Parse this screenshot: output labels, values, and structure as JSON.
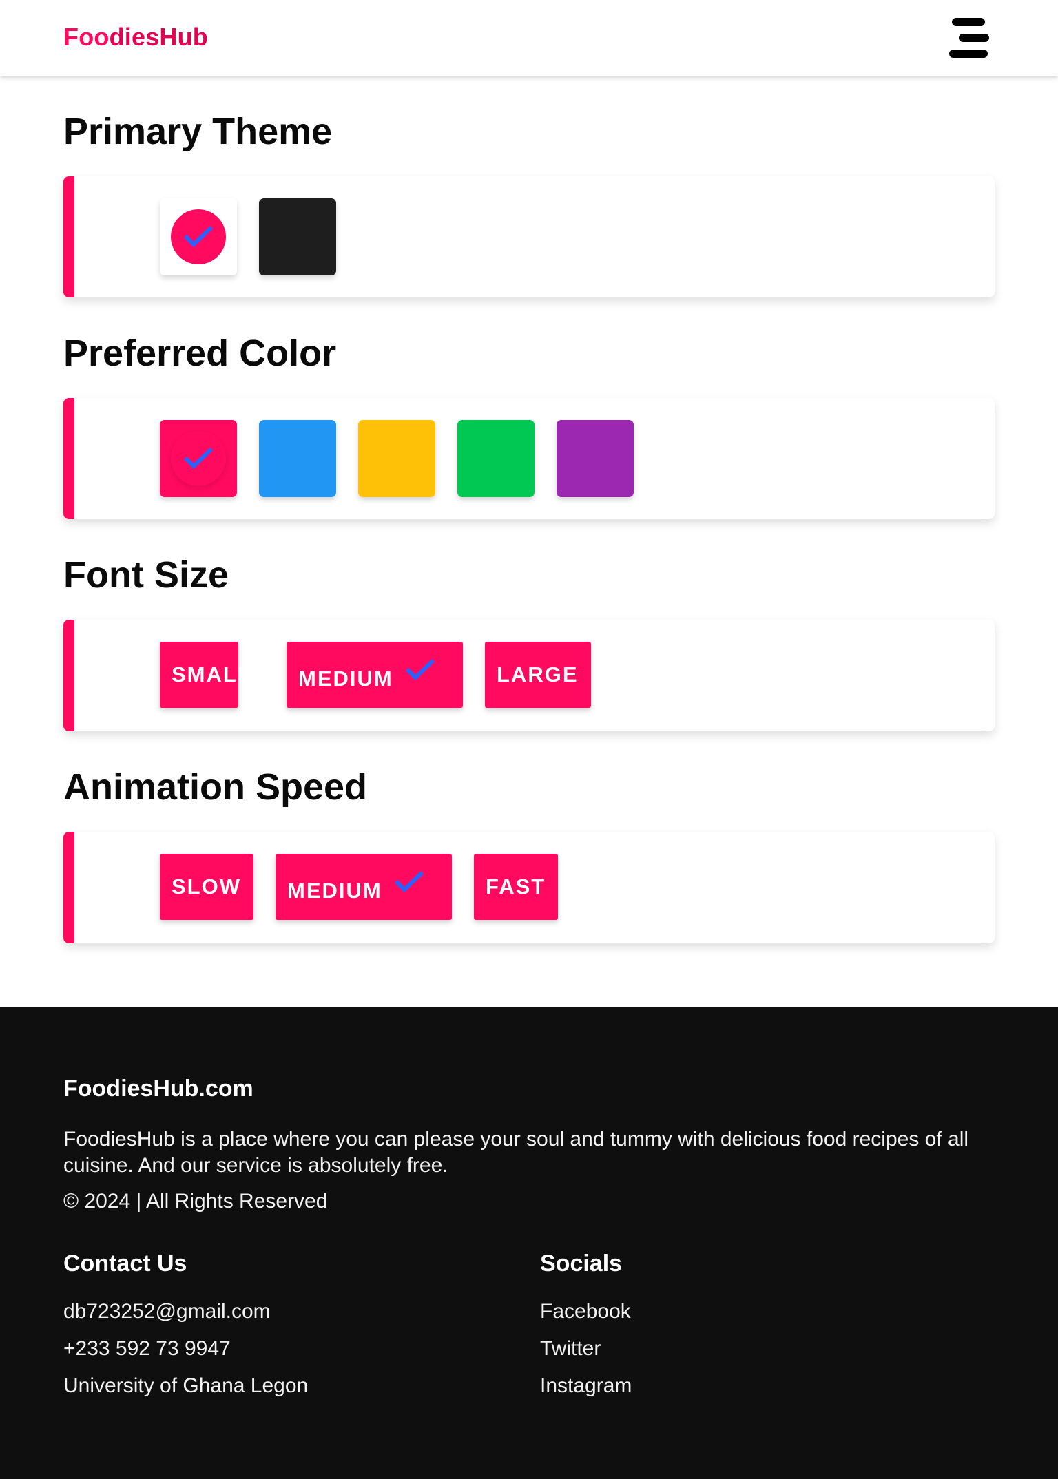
{
  "header": {
    "brand_part1": "Foo",
    "brand_part2": "diesHub",
    "menu_icon": "hamburger-menu-icon"
  },
  "sections": {
    "primary_theme": {
      "title": "Primary Theme",
      "options": [
        {
          "name": "light",
          "color": "#ffffff",
          "selected": true
        },
        {
          "name": "dark",
          "color": "#1e1e1e",
          "selected": false
        }
      ]
    },
    "preferred_color": {
      "title": "Preferred Color",
      "options": [
        {
          "name": "pink",
          "color": "#ff0a5e",
          "selected": true
        },
        {
          "name": "blue",
          "color": "#2196f3",
          "selected": false
        },
        {
          "name": "amber",
          "color": "#ffc107",
          "selected": false
        },
        {
          "name": "green",
          "color": "#00c853",
          "selected": false
        },
        {
          "name": "purple",
          "color": "#9c27b0",
          "selected": false
        }
      ]
    },
    "font_size": {
      "title": "Font Size",
      "options": [
        {
          "label": "SMALL",
          "selected": false
        },
        {
          "label": "MEDIUM",
          "selected": true
        },
        {
          "label": "LARGE",
          "selected": false
        }
      ]
    },
    "animation_speed": {
      "title": "Animation Speed",
      "options": [
        {
          "label": "SLOW",
          "selected": false
        },
        {
          "label": "MEDIUM",
          "selected": true
        },
        {
          "label": "FAST",
          "selected": false
        }
      ]
    }
  },
  "colors": {
    "accent": "#ff0a5e",
    "check": "#2962ff",
    "footer_bg": "#0f0f0f"
  },
  "footer": {
    "title": "FoodiesHub.com",
    "description": "FoodiesHub is a place where you can please your soul and tummy with delicious food recipes of all cuisine. And our service is absolutely free.",
    "copyright": "© 2024 | All Rights Reserved",
    "contact": {
      "title": "Contact Us",
      "email": "db723252@gmail.com",
      "phone": "+233 592 73 9947",
      "address": "University of Ghana Legon"
    },
    "socials": {
      "title": "Socials",
      "links": [
        "Facebook",
        "Twitter",
        "Instagram"
      ]
    }
  }
}
